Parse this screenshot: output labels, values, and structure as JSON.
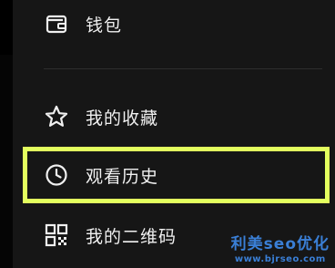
{
  "menu": {
    "items": [
      {
        "label": "钱包",
        "icon": "wallet-icon"
      },
      {
        "label": "我的收藏",
        "icon": "star-icon"
      },
      {
        "label": "观看历史",
        "icon": "clock-icon"
      },
      {
        "label": "我的二维码",
        "icon": "qr-code-icon"
      }
    ]
  },
  "highlight": {
    "color": "#e3ff5e",
    "target": "观看历史"
  },
  "watermark": {
    "title": "利美seo优化",
    "url": "www.bjrseo.com"
  }
}
